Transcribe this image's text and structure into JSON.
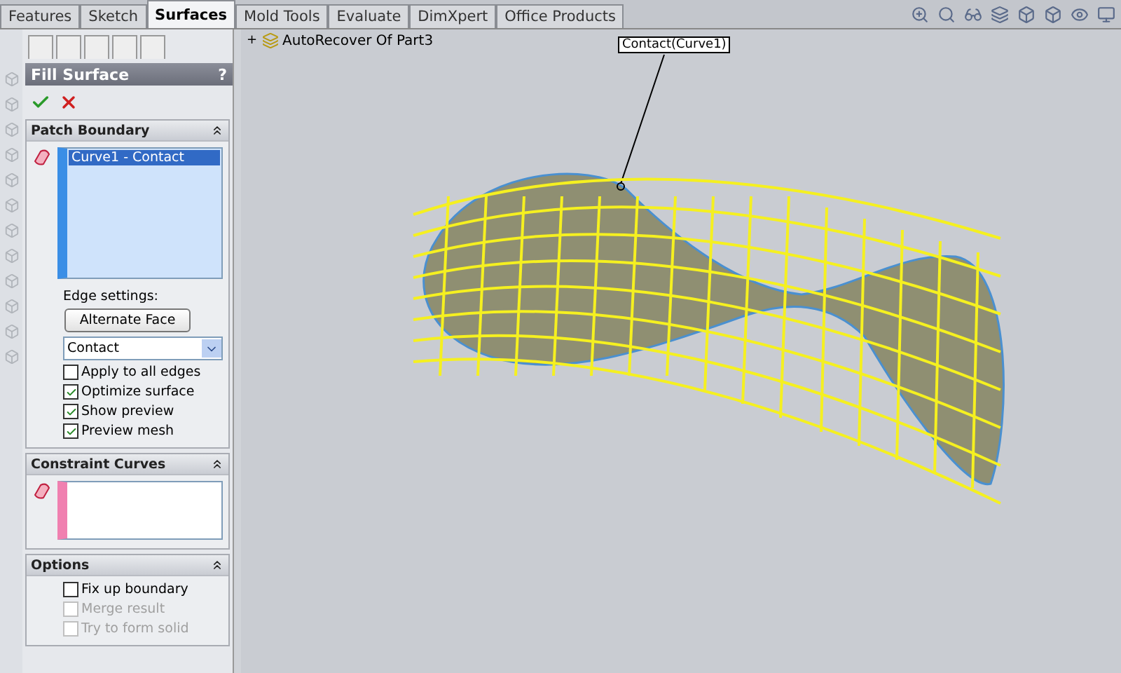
{
  "tabs": [
    {
      "label": "Features",
      "selected": false
    },
    {
      "label": "Sketch",
      "selected": false
    },
    {
      "label": "Surfaces",
      "selected": true
    },
    {
      "label": "Mold Tools",
      "selected": false
    },
    {
      "label": "Evaluate",
      "selected": false
    },
    {
      "label": "DimXpert",
      "selected": false
    },
    {
      "label": "Office Products",
      "selected": false
    }
  ],
  "feature_tree": {
    "expander": "+",
    "item": "AutoRecover Of Part3"
  },
  "panel": {
    "title": "Fill Surface",
    "help": "?",
    "patch_boundary": {
      "title": "Patch Boundary",
      "items": [
        {
          "label": "Curve1 - Contact",
          "selected": true
        }
      ],
      "edge_settings_label": "Edge settings:",
      "button": "Alternate Face",
      "dropdown": {
        "value": "Contact"
      },
      "checkboxes": [
        {
          "label": "Apply to all edges",
          "checked": false,
          "disabled": false
        },
        {
          "label": "Optimize surface",
          "checked": true,
          "disabled": false
        },
        {
          "label": "Show preview",
          "checked": true,
          "disabled": false
        },
        {
          "label": "Preview mesh",
          "checked": true,
          "disabled": false
        }
      ]
    },
    "constraint_curves": {
      "title": "Constraint Curves"
    },
    "options": {
      "title": "Options",
      "checkboxes": [
        {
          "label": "Fix up boundary",
          "checked": false,
          "disabled": false
        },
        {
          "label": "Merge result",
          "checked": false,
          "disabled": true
        },
        {
          "label": "Try to form solid",
          "checked": false,
          "disabled": true
        }
      ]
    }
  },
  "callout": {
    "label": "Contact(Curve1)"
  }
}
